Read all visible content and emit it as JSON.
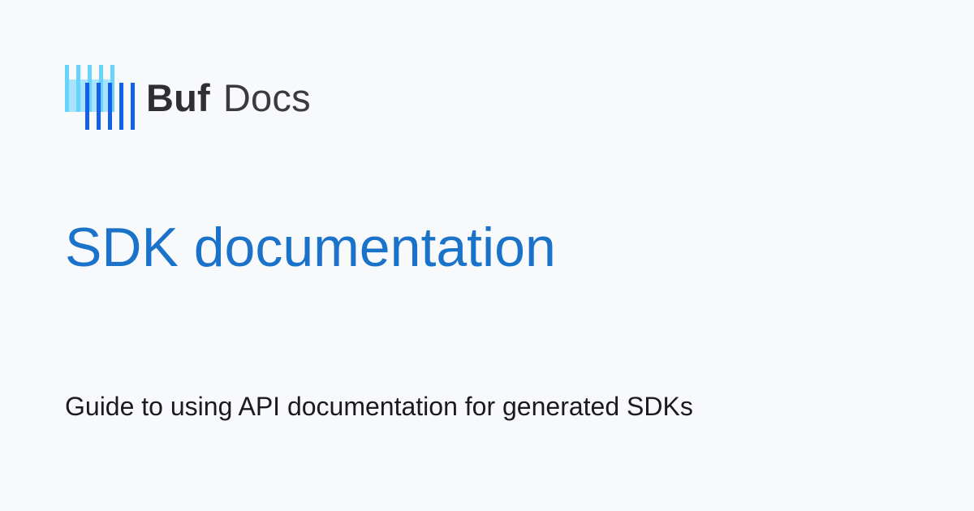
{
  "brand": {
    "name": "Buf",
    "product": "Docs",
    "logo_icon": "buf-logo-icon",
    "colors": {
      "light_bars": "#67d3ff",
      "dark_bars": "#1560e8"
    }
  },
  "page": {
    "title": "SDK documentation",
    "subtitle": "Guide to using API documentation for generated SDKs",
    "colors": {
      "background": "#f8f9fb",
      "title": "#1a73c9",
      "subtitle": "#1b1b1f"
    }
  }
}
